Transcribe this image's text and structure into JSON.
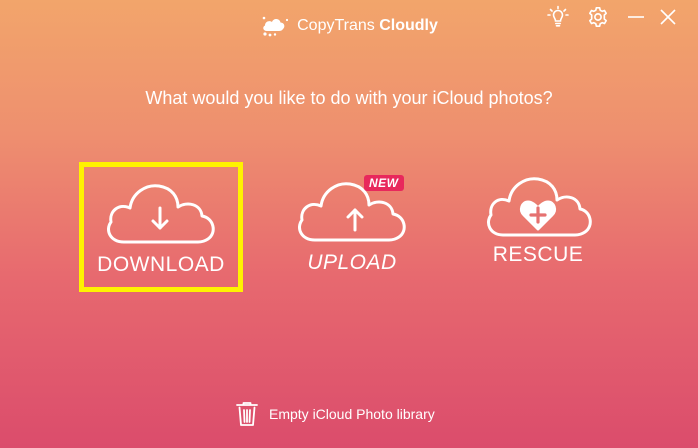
{
  "titlebar": {
    "brand_prefix": "CopyTrans",
    "brand_name": "Cloudly",
    "icons": [
      "lightbulb-icon",
      "gear-icon",
      "minimize-icon",
      "close-icon"
    ]
  },
  "prompt": "What would you like to do with your iCloud photos?",
  "actions": [
    {
      "label": "DOWNLOAD",
      "icon": "cloud-download-icon",
      "selected": true
    },
    {
      "label": "UPLOAD",
      "icon": "cloud-upload-icon",
      "badge": "NEW"
    },
    {
      "label": "RESCUE",
      "icon": "cloud-heart-icon"
    }
  ],
  "footer": {
    "empty_library_label": "Empty iCloud Photo library",
    "icon": "trash-icon"
  },
  "colors": {
    "selection_border": "#fff200",
    "new_badge": "#e8285c",
    "gradient_top": "#f2a56b",
    "gradient_bottom": "#db4c6c"
  }
}
